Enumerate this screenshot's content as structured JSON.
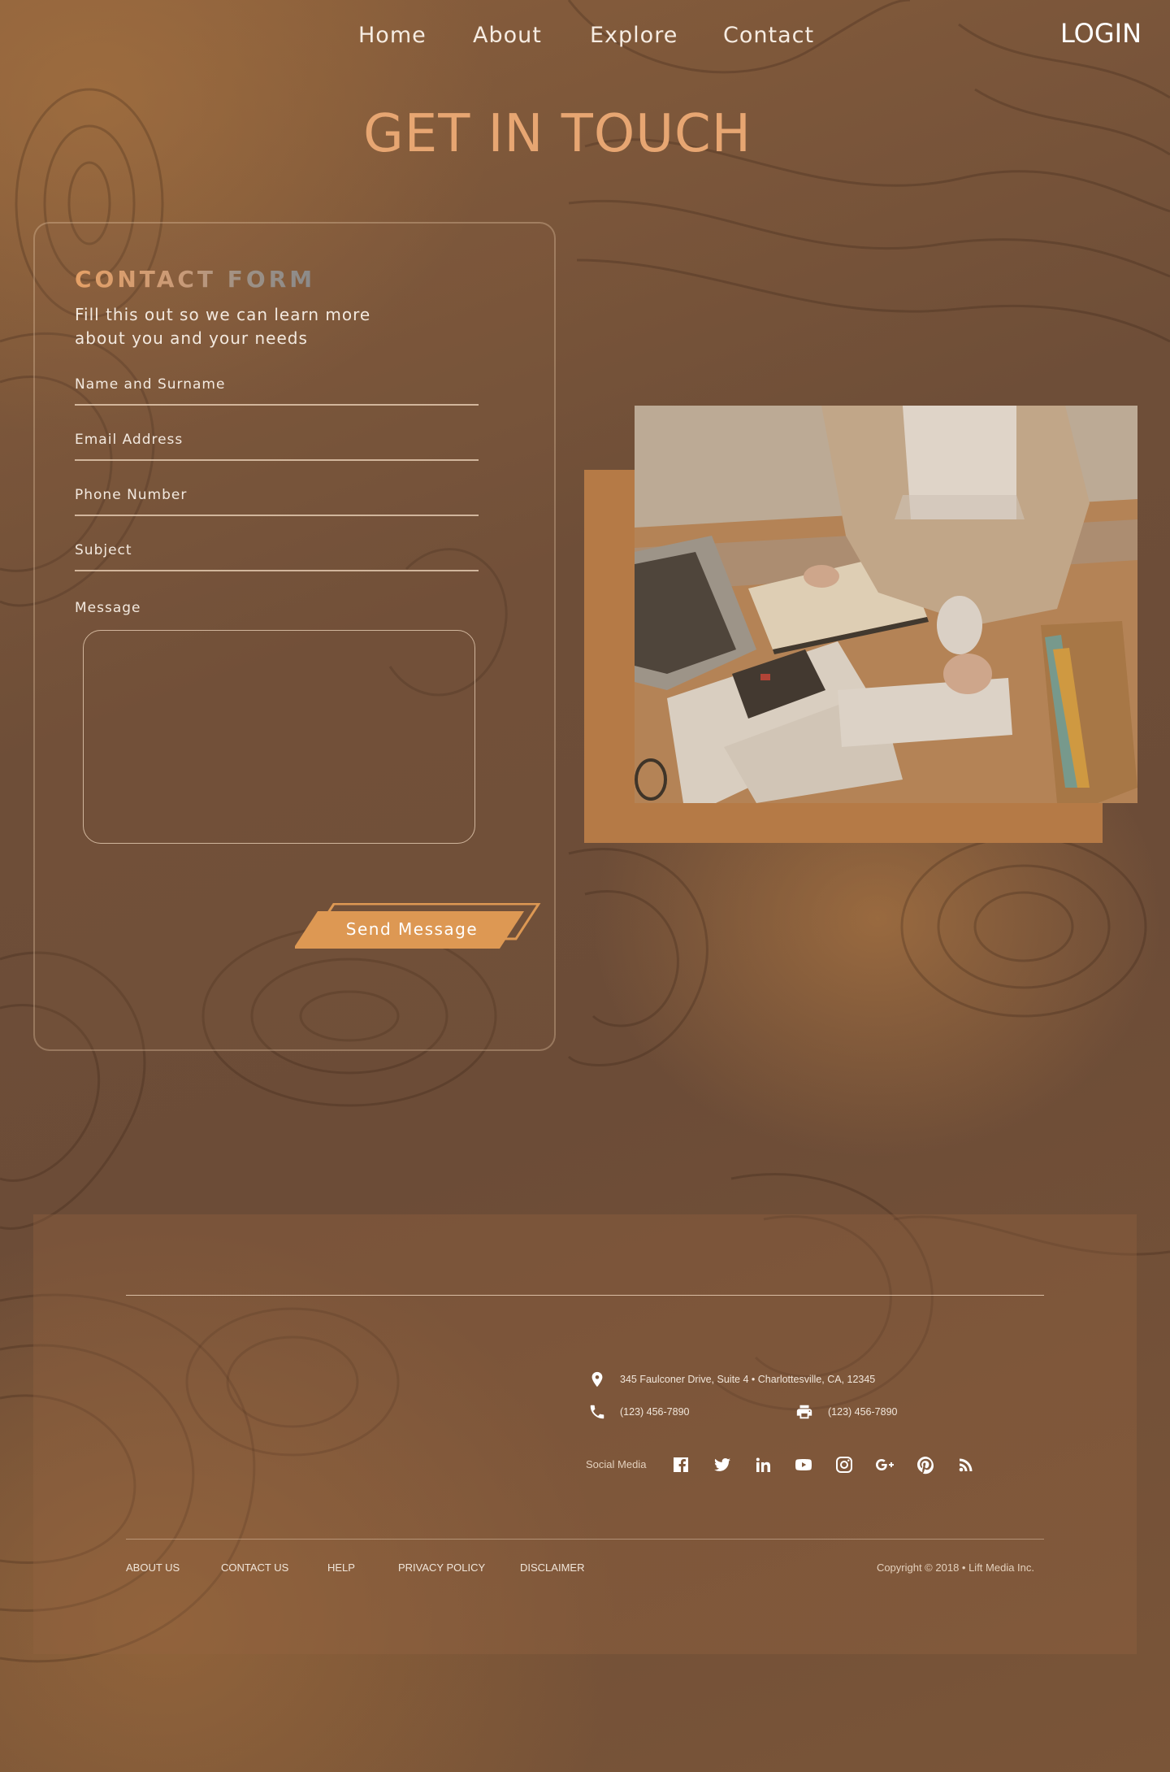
{
  "nav": {
    "items": [
      {
        "label": "Home"
      },
      {
        "label": "About"
      },
      {
        "label": "Explore"
      },
      {
        "label": "Contact"
      }
    ],
    "login_label": "LOGIN"
  },
  "hero": {
    "title": "GET IN TOUCH"
  },
  "contact_form": {
    "title": "CONTACT FORM",
    "subtitle": "Fill this out so we can learn more about you and your needs",
    "fields": [
      {
        "label": "Name and Surname"
      },
      {
        "label": "Email Address"
      },
      {
        "label": "Phone Number"
      },
      {
        "label": "Subject"
      }
    ],
    "message_label": "Message",
    "submit_label": "Send Message"
  },
  "photo": {
    "subject": "person writing in notebook at desk with laptop, calculator and keyboard"
  },
  "footer": {
    "address": "345 Faulconer Drive, Suite 4 • Charlottesville, CA, 12345",
    "phone": "(123) 456-7890",
    "fax": "(123) 456-7890",
    "social_label": "Social Media",
    "social_icons": [
      "facebook-icon",
      "twitter-icon",
      "linkedin-icon",
      "youtube-icon",
      "instagram-icon",
      "google-plus-icon",
      "pinterest-icon",
      "rss-icon"
    ],
    "links": [
      "ABOUT US",
      "CONTACT US",
      "HELP",
      "PRIVACY POLICY",
      "DISCLAIMER"
    ],
    "copyright": "Copyright © 2018 • Lift Media Inc."
  },
  "colors": {
    "accent": "#e7a672",
    "button": "#dd9853",
    "photo_backdrop": "#b57a46",
    "text": "#f3e9df"
  }
}
